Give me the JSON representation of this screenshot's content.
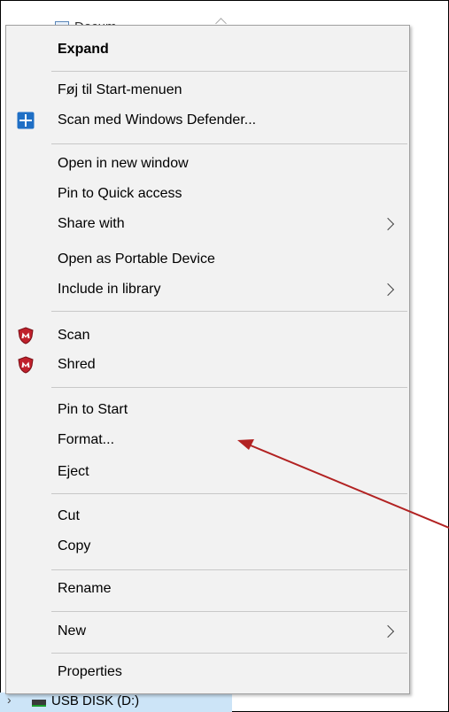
{
  "background": {
    "top_item_label": "Documents",
    "bottom_item_label": "USB DISK (D:)"
  },
  "menu": {
    "expand": "Expand",
    "pin_start_menu": "Føj til Start-menuen",
    "scan_defender": "Scan med Windows Defender...",
    "open_new_window": "Open in new window",
    "pin_quick_access": "Pin to Quick access",
    "share_with": "Share with",
    "open_portable": "Open as Portable Device",
    "include_library": "Include in library",
    "scan": "Scan",
    "shred": "Shred",
    "pin_to_start": "Pin to Start",
    "format": "Format...",
    "eject": "Eject",
    "cut": "Cut",
    "copy": "Copy",
    "rename": "Rename",
    "new": "New",
    "properties": "Properties"
  },
  "icons": {
    "defender": "windows-defender-shield-icon",
    "mcafee": "mcafee-shield-icon"
  },
  "colors": {
    "menu_bg": "#f2f2f2",
    "separator": "#c8c8c8",
    "defender_blue": "#1f6fc5",
    "mcafee_red": "#c0212c",
    "annotation_arrow": "#b22222",
    "selection_bg": "#cce4f7"
  }
}
